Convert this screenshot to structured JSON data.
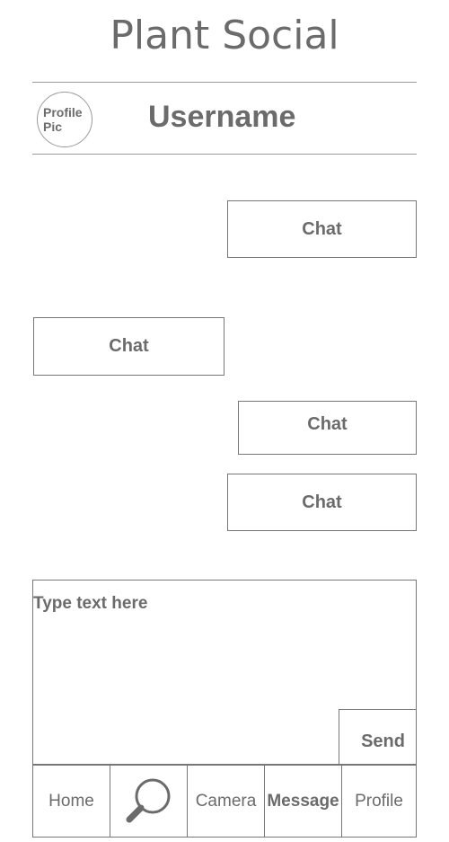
{
  "app": {
    "title": "Plant Social"
  },
  "header": {
    "avatar_label": "Profile Pic",
    "username": "Username"
  },
  "chats": [
    "Chat",
    "Chat",
    "Chat",
    "Chat"
  ],
  "composer": {
    "placeholder": "Type text here",
    "send_label": "Send"
  },
  "nav": {
    "home": "Home",
    "search_icon": "search-icon",
    "camera": "Camera",
    "message": "Message",
    "profile": "Profile"
  }
}
